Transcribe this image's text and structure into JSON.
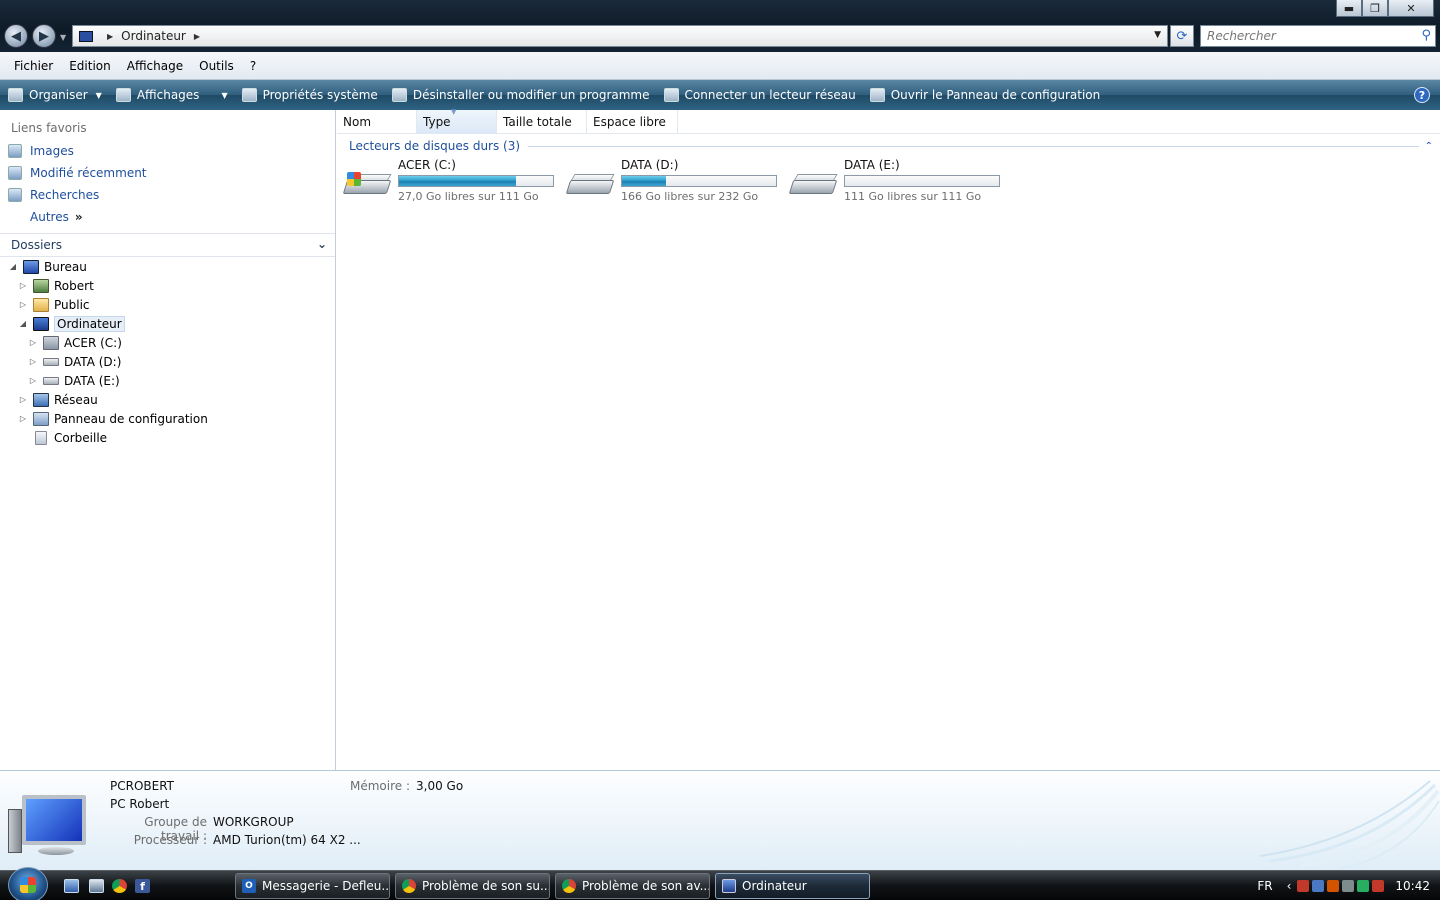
{
  "window": {
    "controls": {
      "minimize": "▬",
      "maximize": "❐",
      "close": "✕"
    }
  },
  "addressbar": {
    "path": [
      "Ordinateur"
    ],
    "refresh_icon": "refresh-icon"
  },
  "search": {
    "placeholder": "Rechercher"
  },
  "menu": [
    "Fichier",
    "Edition",
    "Affichage",
    "Outils",
    "?"
  ],
  "commands": [
    {
      "label": "Organiser",
      "dropdown": true
    },
    {
      "label": "Affichages",
      "dropdown": true
    },
    {
      "label": "Propriétés système",
      "dropdown": false
    },
    {
      "label": "Désinstaller ou modifier un programme",
      "dropdown": false
    },
    {
      "label": "Connecter un lecteur réseau",
      "dropdown": false
    },
    {
      "label": "Ouvrir le Panneau de configuration",
      "dropdown": false
    }
  ],
  "nav": {
    "favorites_title": "Liens favoris",
    "favorites": [
      "Images",
      "Modifié récemment",
      "Recherches",
      "Autres"
    ],
    "folders_title": "Dossiers",
    "tree": [
      {
        "label": "Bureau",
        "level": 0,
        "expanded": true
      },
      {
        "label": "Robert",
        "level": 1,
        "expanded": false
      },
      {
        "label": "Public",
        "level": 1,
        "expanded": false
      },
      {
        "label": "Ordinateur",
        "level": 1,
        "expanded": true,
        "selected": true
      },
      {
        "label": "ACER (C:)",
        "level": 2,
        "expanded": false
      },
      {
        "label": "DATA (D:)",
        "level": 2,
        "expanded": false
      },
      {
        "label": "DATA (E:)",
        "level": 2,
        "expanded": false
      },
      {
        "label": "Réseau",
        "level": 1,
        "expanded": false
      },
      {
        "label": "Panneau de configuration",
        "level": 1,
        "expanded": false
      },
      {
        "label": "Corbeille",
        "level": 1,
        "expanded": null
      }
    ]
  },
  "columns": [
    "Nom",
    "Type",
    "Taille totale",
    "Espace libre"
  ],
  "group": {
    "title": "Lecteurs de disques durs (3)"
  },
  "drives": [
    {
      "name": "ACER (C:)",
      "free_text": "27,0 Go libres sur 111 Go",
      "used_fraction": 0.757,
      "system": true
    },
    {
      "name": "DATA (D:)",
      "free_text": "166 Go libres sur 232 Go",
      "used_fraction": 0.284,
      "system": false
    },
    {
      "name": "DATA (E:)",
      "free_text": "111 Go libres sur 111 Go",
      "used_fraction": 0.0,
      "system": false
    }
  ],
  "details": {
    "computer_name": "PCROBERT",
    "description": "PC Robert",
    "workgroup_label": "Groupe de travail :",
    "workgroup": "WORKGROUP",
    "processor_label": "Processeur :",
    "processor": "AMD Turion(tm) 64 X2 ...",
    "memory_label": "Mémoire :",
    "memory": "3,00 Go"
  },
  "taskbar": {
    "buttons": [
      {
        "label": "Messagerie - Defleu...",
        "icon": "outlook-icon"
      },
      {
        "label": "Problème de son su...",
        "icon": "chrome-icon"
      },
      {
        "label": "Problème de son av...",
        "icon": "chrome-icon"
      },
      {
        "label": "Ordinateur",
        "icon": "computer-icon",
        "active": true
      }
    ],
    "language": "FR",
    "clock": "10:42"
  }
}
